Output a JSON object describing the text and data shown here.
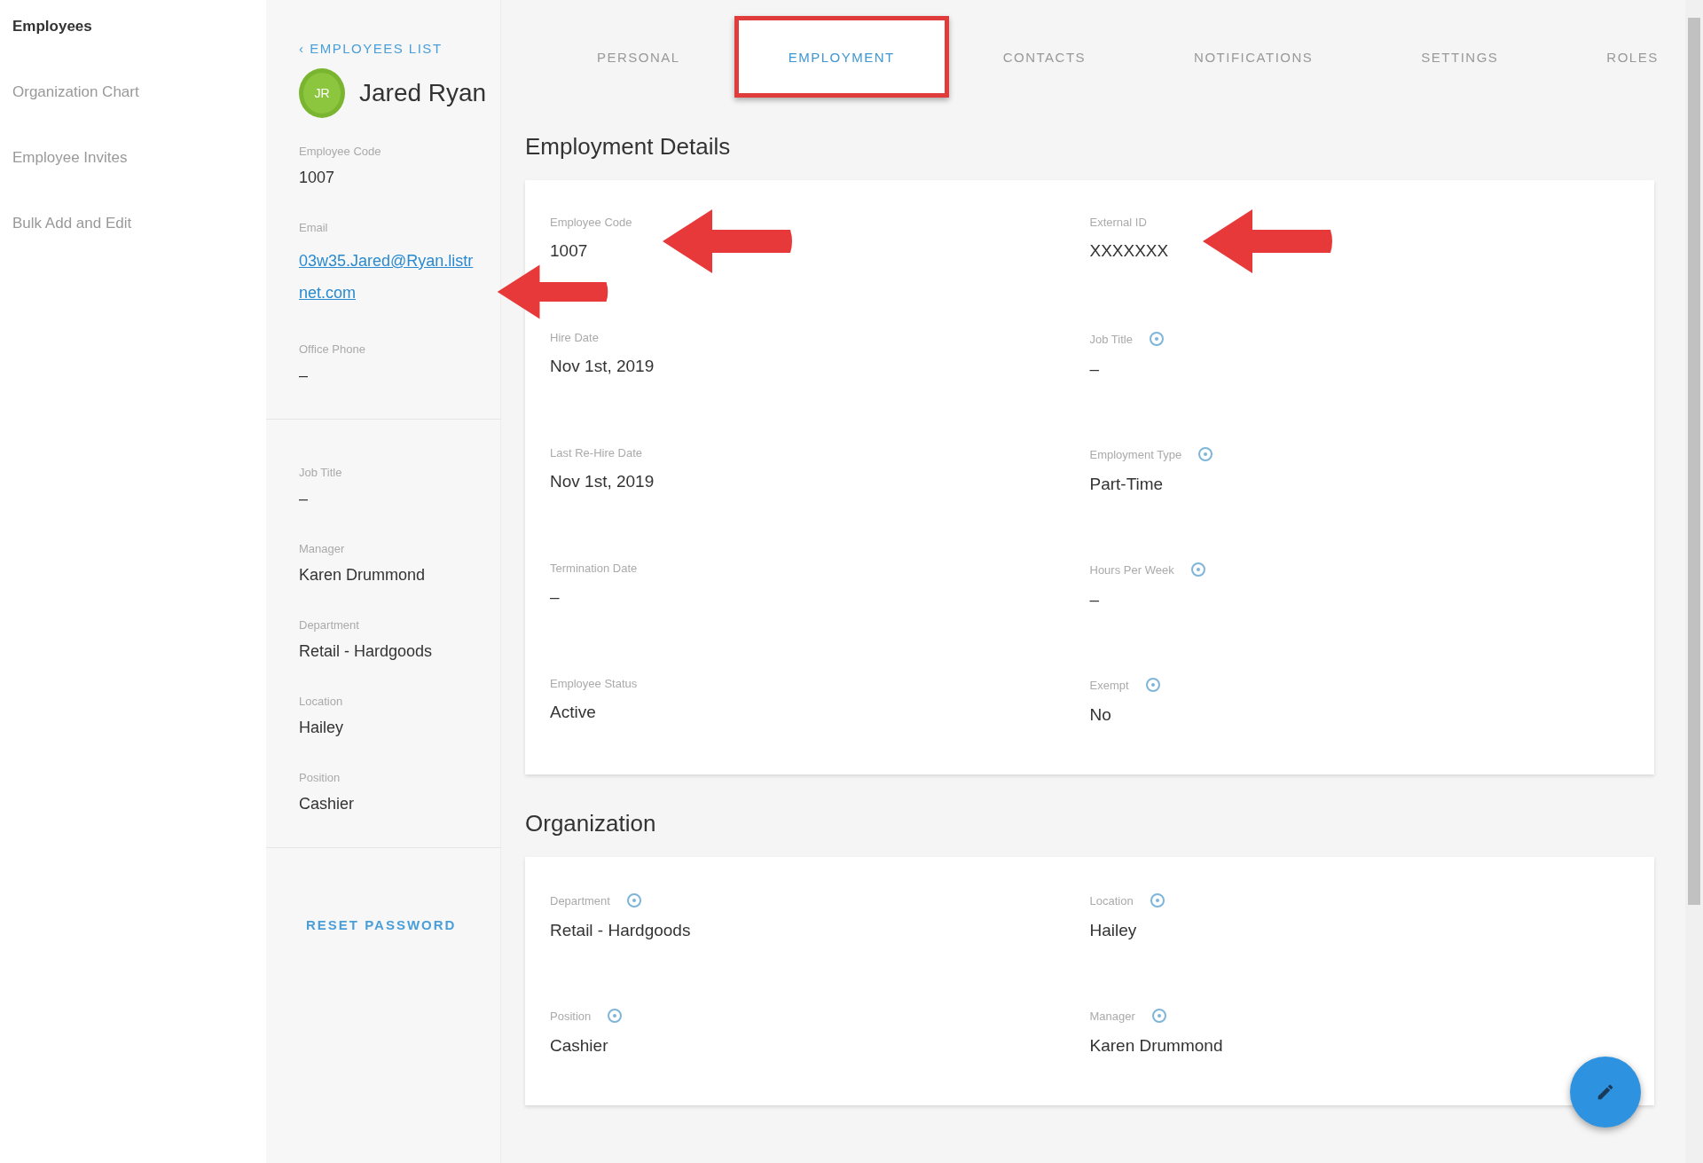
{
  "sidebar": {
    "items": [
      {
        "label": "Employees",
        "selected": true
      },
      {
        "label": "Organization Chart",
        "selected": false
      },
      {
        "label": "Employee Invites",
        "selected": false
      },
      {
        "label": "Bulk Add and Edit",
        "selected": false
      }
    ]
  },
  "profile": {
    "back_link": "‹ EMPLOYEES LIST",
    "avatar_initials": "JR",
    "name": "Jared Ryan",
    "fields": [
      {
        "label": "Employee Code",
        "value": "1007",
        "kind": "text",
        "arrow": false
      },
      {
        "label": "Email",
        "value": "03w35.Jared@Ryan.listrnet.com",
        "kind": "link",
        "arrow": true
      },
      {
        "label": "Office Phone",
        "value": "–",
        "kind": "text",
        "arrow": false
      },
      {
        "kind": "divider"
      },
      {
        "label": "Job Title",
        "value": "–",
        "kind": "text",
        "arrow": false
      },
      {
        "label": "Manager",
        "value": "Karen Drummond",
        "kind": "text",
        "arrow": false
      },
      {
        "label": "Department",
        "value": "Retail - Hardgoods",
        "kind": "text",
        "arrow": false
      },
      {
        "label": "Location",
        "value": "Hailey",
        "kind": "text",
        "arrow": false
      },
      {
        "label": "Position",
        "value": "Cashier",
        "kind": "text",
        "arrow": false
      },
      {
        "kind": "divider"
      }
    ],
    "reset_password": "RESET PASSWORD"
  },
  "tabs": [
    {
      "label": "PERSONAL",
      "selected": false,
      "highlighted": false
    },
    {
      "label": "EMPLOYMENT",
      "selected": true,
      "highlighted": true
    },
    {
      "label": "CONTACTS",
      "selected": false,
      "highlighted": false
    },
    {
      "label": "NOTIFICATIONS",
      "selected": false,
      "highlighted": false
    },
    {
      "label": "SETTINGS",
      "selected": false,
      "highlighted": false
    },
    {
      "label": "ROLES",
      "selected": false,
      "highlighted": false
    }
  ],
  "sections": [
    {
      "title": "Employment Details",
      "fields": [
        {
          "label": "Employee Code",
          "value": "1007",
          "help": false,
          "arrow": true
        },
        {
          "label": "External ID",
          "value": "XXXXXXX",
          "help": false,
          "arrow": true
        },
        {
          "label": "Hire Date",
          "value": "Nov 1st, 2019",
          "help": false,
          "arrow": false
        },
        {
          "label": "Job Title",
          "value": "–",
          "help": true,
          "arrow": false
        },
        {
          "label": "Last Re-Hire Date",
          "value": "Nov 1st, 2019",
          "help": false,
          "arrow": false
        },
        {
          "label": "Employment Type",
          "value": "Part-Time",
          "help": true,
          "arrow": false
        },
        {
          "label": "Termination Date",
          "value": "–",
          "help": false,
          "arrow": false
        },
        {
          "label": "Hours Per Week",
          "value": "–",
          "help": true,
          "arrow": false
        },
        {
          "label": "Employee Status",
          "value": "Active",
          "help": false,
          "arrow": false
        },
        {
          "label": "Exempt",
          "value": "No",
          "help": true,
          "arrow": false
        }
      ]
    },
    {
      "title": "Organization",
      "fields": [
        {
          "label": "Department",
          "value": "Retail - Hardgoods",
          "help": true,
          "arrow": false
        },
        {
          "label": "Location",
          "value": "Hailey",
          "help": true,
          "arrow": false
        },
        {
          "label": "Position",
          "value": "Cashier",
          "help": true,
          "arrow": false
        },
        {
          "label": "Manager",
          "value": "Karen Drummond",
          "help": true,
          "arrow": false
        }
      ]
    }
  ]
}
